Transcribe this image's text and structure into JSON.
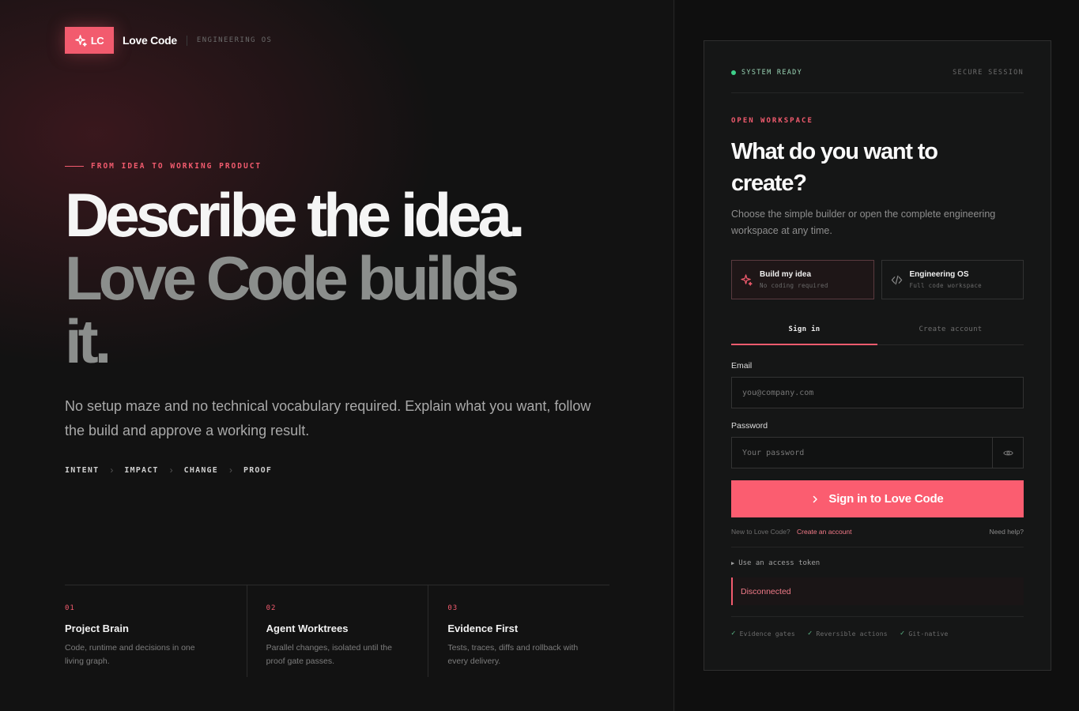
{
  "brand": {
    "logo_text": "LC",
    "name": "Love Code",
    "tag": "ENGINEERING OS",
    "accent": "#f25b6e"
  },
  "hero": {
    "eyebrow": "FROM IDEA TO WORKING PRODUCT",
    "line1": "Describe the idea.",
    "line2": "Love Code builds",
    "line3": "it.",
    "subtitle": "No setup maze and no technical vocabulary required. Explain what you want, follow the build and approve a working result."
  },
  "steps": [
    "INTENT",
    "IMPACT",
    "CHANGE",
    "PROOF"
  ],
  "features": [
    {
      "num": "01",
      "title": "Project Brain",
      "desc": "Code, runtime and decisions in one living graph."
    },
    {
      "num": "02",
      "title": "Agent Worktrees",
      "desc": "Parallel changes, isolated until the proof gate passes."
    },
    {
      "num": "03",
      "title": "Evidence First",
      "desc": "Tests, traces, diffs and rollback with every delivery."
    }
  ],
  "card": {
    "status": "SYSTEM READY",
    "secure": "SECURE SESSION",
    "eyebrow": "OPEN WORKSPACE",
    "title": "What do you want to create?",
    "description": "Choose the simple builder or open the complete engineering workspace at any time.",
    "modes": [
      {
        "title": "Build my idea",
        "sub": "No coding required",
        "icon": "sparkle-icon",
        "active": true
      },
      {
        "title": "Engineering OS",
        "sub": "Full code workspace",
        "icon": "code-icon",
        "active": false
      }
    ],
    "tabs": {
      "signin": "Sign in",
      "create": "Create account"
    },
    "email": {
      "label": "Email",
      "placeholder": "you@company.com",
      "value": ""
    },
    "password": {
      "label": "Password",
      "placeholder": "Your password",
      "value": ""
    },
    "submit": "Sign in to Love Code",
    "new_text": "New to Love Code?",
    "create_link": "Create an account",
    "help": "Need help?",
    "token": "Use an access token",
    "connection": "Disconnected",
    "badges": [
      "Evidence gates",
      "Reversible actions",
      "Git-native"
    ],
    "status_color": "#3ed08a"
  }
}
